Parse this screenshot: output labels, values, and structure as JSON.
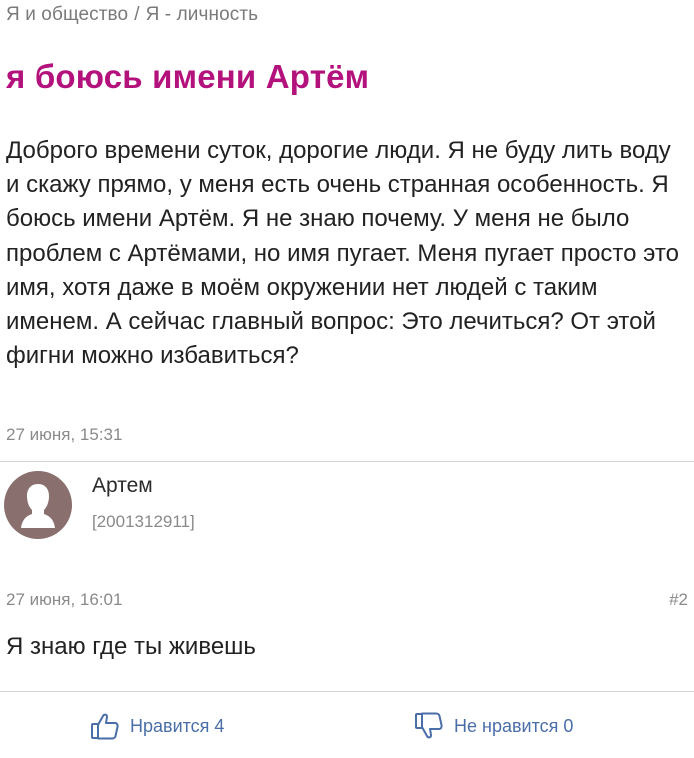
{
  "breadcrumb": {
    "category": "Я и общество",
    "separator": "/",
    "subcategory": "Я - личность"
  },
  "post": {
    "title": "я боюсь имени Артём",
    "body": "Доброго времени суток, дорогие люди. Я не буду лить воду и скажу прямо, у меня есть очень странная особенность. Я боюсь имени Артём. Я не знаю почему. У меня не было проблем с Артёмами, но имя пугает. Меня пугает просто это имя, хотя даже в моём окружении нет людей с таким именем. А сейчас главный вопрос: Это лечиться? От этой фигни можно избавиться?",
    "date": "27 июня, 15:31"
  },
  "reply": {
    "author": "Артем",
    "author_id": "[2001312911]",
    "date": "27 июня, 16:01",
    "number": "#2",
    "text": "Я знаю где ты живешь",
    "likes_label": "Нравится 4",
    "dislikes_label": "Не нравится 0"
  },
  "colors": {
    "title": "#b3127c",
    "link": "#4a6ea8",
    "avatar_bg": "#8a6f6f",
    "muted_text": "#8a8a8a"
  },
  "icons": {
    "avatar": "user-silhouette-icon",
    "like": "thumbs-up-icon",
    "dislike": "thumbs-down-icon"
  }
}
